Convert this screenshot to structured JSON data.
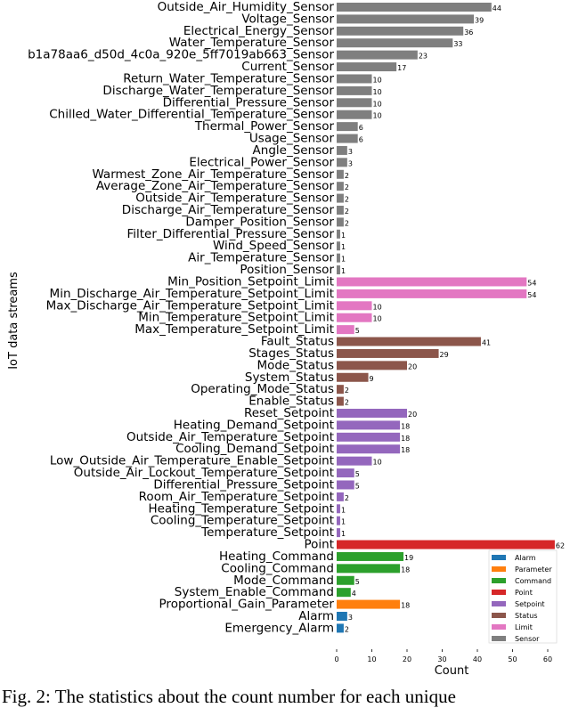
{
  "chart_data": {
    "type": "bar",
    "orientation": "horizontal",
    "xlabel": "Count",
    "ylabel": "IoT data streams",
    "xlim": [
      0,
      62
    ],
    "xticks": [
      0,
      10,
      20,
      30,
      40,
      50,
      60
    ],
    "grid": false,
    "legend_placement": "lower-right",
    "legend": [
      {
        "name": "Alarm",
        "color": "#1f77b4"
      },
      {
        "name": "Parameter",
        "color": "#ff7f0e"
      },
      {
        "name": "Command",
        "color": "#2ca02c"
      },
      {
        "name": "Point",
        "color": "#d62728"
      },
      {
        "name": "Setpoint",
        "color": "#9467bd"
      },
      {
        "name": "Status",
        "color": "#8c564b"
      },
      {
        "name": "Limit",
        "color": "#e377c2"
      },
      {
        "name": "Sensor",
        "color": "#7f7f7f"
      }
    ],
    "bars": [
      {
        "label": "Outside_Air_Humidity_Sensor",
        "value": 44,
        "group": "Sensor"
      },
      {
        "label": "Voltage_Sensor",
        "value": 39,
        "group": "Sensor"
      },
      {
        "label": "Electrical_Energy_Sensor",
        "value": 36,
        "group": "Sensor"
      },
      {
        "label": "Water_Temperature_Sensor",
        "value": 33,
        "group": "Sensor"
      },
      {
        "label": "b1a78aa6_d50d_4c0a_920e_5ff7019ab663_Sensor",
        "value": 23,
        "group": "Sensor"
      },
      {
        "label": "Current_Sensor",
        "value": 17,
        "group": "Sensor"
      },
      {
        "label": "Return_Water_Temperature_Sensor",
        "value": 10,
        "group": "Sensor"
      },
      {
        "label": "Discharge_Water_Temperature_Sensor",
        "value": 10,
        "group": "Sensor"
      },
      {
        "label": "Differential_Pressure_Sensor",
        "value": 10,
        "group": "Sensor"
      },
      {
        "label": "Chilled_Water_Differential_Temperature_Sensor",
        "value": 10,
        "group": "Sensor"
      },
      {
        "label": "Thermal_Power_Sensor",
        "value": 6,
        "group": "Sensor"
      },
      {
        "label": "Usage_Sensor",
        "value": 6,
        "group": "Sensor"
      },
      {
        "label": "Angle_Sensor",
        "value": 3,
        "group": "Sensor"
      },
      {
        "label": "Electrical_Power_Sensor",
        "value": 3,
        "group": "Sensor"
      },
      {
        "label": "Warmest_Zone_Air_Temperature_Sensor",
        "value": 2,
        "group": "Sensor"
      },
      {
        "label": "Average_Zone_Air_Temperature_Sensor",
        "value": 2,
        "group": "Sensor"
      },
      {
        "label": "Outside_Air_Temperature_Sensor",
        "value": 2,
        "group": "Sensor"
      },
      {
        "label": "Discharge_Air_Temperature_Sensor",
        "value": 2,
        "group": "Sensor"
      },
      {
        "label": "Damper_Position_Sensor",
        "value": 2,
        "group": "Sensor"
      },
      {
        "label": "Filter_Differential_Pressure_Sensor",
        "value": 1,
        "group": "Sensor"
      },
      {
        "label": "Wind_Speed_Sensor",
        "value": 1,
        "group": "Sensor"
      },
      {
        "label": "Air_Temperature_Sensor",
        "value": 1,
        "group": "Sensor"
      },
      {
        "label": "Position_Sensor",
        "value": 1,
        "group": "Sensor"
      },
      {
        "label": "Min_Position_Setpoint_Limit",
        "value": 54,
        "group": "Limit"
      },
      {
        "label": "Min_Discharge_Air_Temperature_Setpoint_Limit",
        "value": 54,
        "group": "Limit"
      },
      {
        "label": "Max_Discharge_Air_Temperature_Setpoint_Limit",
        "value": 10,
        "group": "Limit"
      },
      {
        "label": "Min_Temperature_Setpoint_Limit",
        "value": 10,
        "group": "Limit"
      },
      {
        "label": "Max_Temperature_Setpoint_Limit",
        "value": 5,
        "group": "Limit"
      },
      {
        "label": "Fault_Status",
        "value": 41,
        "group": "Status"
      },
      {
        "label": "Stages_Status",
        "value": 29,
        "group": "Status"
      },
      {
        "label": "Mode_Status",
        "value": 20,
        "group": "Status"
      },
      {
        "label": "System_Status",
        "value": 9,
        "group": "Status"
      },
      {
        "label": "Operating_Mode_Status",
        "value": 2,
        "group": "Status"
      },
      {
        "label": "Enable_Status",
        "value": 2,
        "group": "Status"
      },
      {
        "label": "Reset_Setpoint",
        "value": 20,
        "group": "Setpoint"
      },
      {
        "label": "Heating_Demand_Setpoint",
        "value": 18,
        "group": "Setpoint"
      },
      {
        "label": "Outside_Air_Temperature_Setpoint",
        "value": 18,
        "group": "Setpoint"
      },
      {
        "label": "Cooling_Demand_Setpoint",
        "value": 18,
        "group": "Setpoint"
      },
      {
        "label": "Low_Outside_Air_Temperature_Enable_Setpoint",
        "value": 10,
        "group": "Setpoint"
      },
      {
        "label": "Outside_Air_Lockout_Temperature_Setpoint",
        "value": 5,
        "group": "Setpoint"
      },
      {
        "label": "Differential_Pressure_Setpoint",
        "value": 5,
        "group": "Setpoint"
      },
      {
        "label": "Room_Air_Temperature_Setpoint",
        "value": 2,
        "group": "Setpoint"
      },
      {
        "label": "Heating_Temperature_Setpoint",
        "value": 1,
        "group": "Setpoint"
      },
      {
        "label": "Cooling_Temperature_Setpoint",
        "value": 1,
        "group": "Setpoint"
      },
      {
        "label": "Temperature_Setpoint",
        "value": 1,
        "group": "Setpoint"
      },
      {
        "label": "Point",
        "value": 62,
        "group": "Point"
      },
      {
        "label": "Heating_Command",
        "value": 19,
        "group": "Command"
      },
      {
        "label": "Cooling_Command",
        "value": 18,
        "group": "Command"
      },
      {
        "label": "Mode_Command",
        "value": 5,
        "group": "Command"
      },
      {
        "label": "System_Enable_Command",
        "value": 4,
        "group": "Command"
      },
      {
        "label": "Proportional_Gain_Parameter",
        "value": 18,
        "group": "Parameter"
      },
      {
        "label": "Alarm",
        "value": 3,
        "group": "Alarm"
      },
      {
        "label": "Emergency_Alarm",
        "value": 2,
        "group": "Alarm"
      }
    ]
  },
  "caption": "Fig. 2: The statistics about the count number for each unique"
}
